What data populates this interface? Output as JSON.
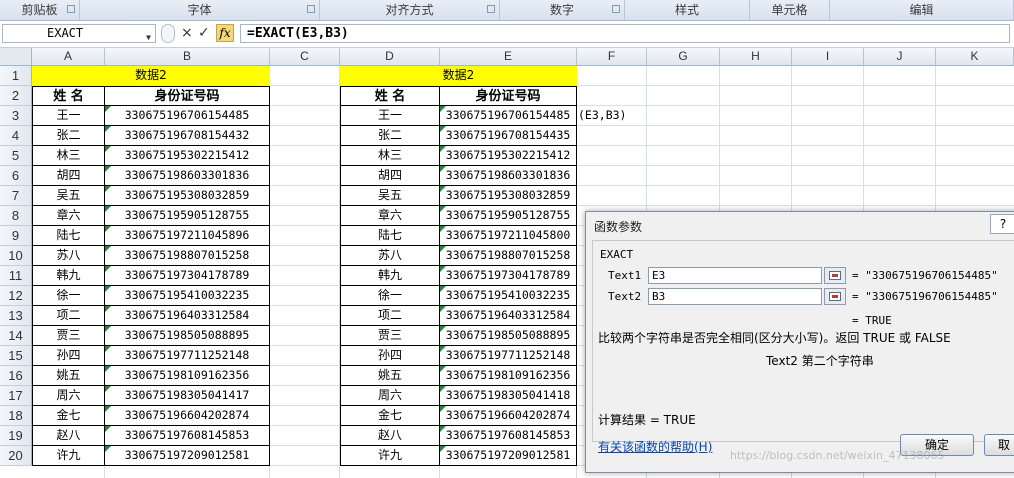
{
  "ribbon": {
    "groups": [
      "剪贴板",
      "字体",
      "对齐方式",
      "数字",
      "样式",
      "单元格",
      "编辑"
    ]
  },
  "formula_bar": {
    "name_box": "EXACT",
    "formula": "=EXACT(E3,B3)",
    "fx_label": "fx",
    "cancel_icon": "×",
    "enter_icon": "✓"
  },
  "columns": [
    "A",
    "B",
    "C",
    "D",
    "E",
    "F",
    "G",
    "H",
    "I",
    "J",
    "K"
  ],
  "rows": [
    "1",
    "2",
    "3",
    "4",
    "5",
    "6",
    "7",
    "8",
    "9",
    "10",
    "11",
    "12",
    "13",
    "14",
    "15",
    "16",
    "17",
    "18",
    "19",
    "20"
  ],
  "left_table": {
    "title": "数据2",
    "headers": [
      "姓 名",
      "身份证号码"
    ],
    "names": [
      "王一",
      "张二",
      "林三",
      "胡四",
      "吴五",
      "章六",
      "陆七",
      "苏八",
      "韩九",
      "徐一",
      "项二",
      "贾三",
      "孙四",
      "姚五",
      "周六",
      "金七",
      "赵八",
      "许九"
    ],
    "ids": [
      "330675196706154485",
      "330675196708154432",
      "330675195302215412",
      "330675198603301836",
      "330675195308032859",
      "330675195905128755",
      "330675197211045896",
      "330675198807015258",
      "330675197304178789",
      "330675195410032235",
      "330675196403312584",
      "330675198505088895",
      "330675197711252148",
      "330675198109162356",
      "330675198305041417",
      "330675196604202874",
      "330675197608145853",
      "330675197209012581"
    ]
  },
  "right_table": {
    "title": "数据2",
    "headers": [
      "姓 名",
      "身份证号码"
    ],
    "names": [
      "王一",
      "张二",
      "林三",
      "胡四",
      "吴五",
      "章六",
      "陆七",
      "苏八",
      "韩九",
      "徐一",
      "项二",
      "贾三",
      "孙四",
      "姚五",
      "周六",
      "金七",
      "赵八",
      "许九"
    ],
    "ids": [
      "330675196706154485",
      "330675196708154435",
      "330675195302215412",
      "330675198603301836",
      "330675195308032859",
      "330675195905128755",
      "330675197211045800",
      "330675198807015258",
      "330675197304178789",
      "330675195410032235",
      "330675196403312584",
      "330675198505088895",
      "330675197711252148",
      "330675198109162356",
      "330675198305041418",
      "330675196604202874",
      "330675197608145853",
      "330675197209012581"
    ]
  },
  "f3_overflow": "(E3,B3)",
  "dialog": {
    "title": "函数参数",
    "help_button": "?",
    "function_name": "EXACT",
    "args": [
      {
        "name": "Text1",
        "value": "E3",
        "result": "= \"330675196706154485\""
      },
      {
        "name": "Text2",
        "value": "B3",
        "result": "= \"330675196706154485\""
      }
    ],
    "func_result": "= TRUE",
    "description": "比较两个字符串是否完全相同(区分大小写)。返回 TRUE 或 FALSE",
    "arg_help": "Text2  第二个字符串",
    "calc_result": "计算结果 = TRUE",
    "help_link": "有关该函数的帮助(H)",
    "ok": "确定",
    "cancel": "取"
  },
  "watermark": "https://blog.csdn.net/weixin_47138065"
}
